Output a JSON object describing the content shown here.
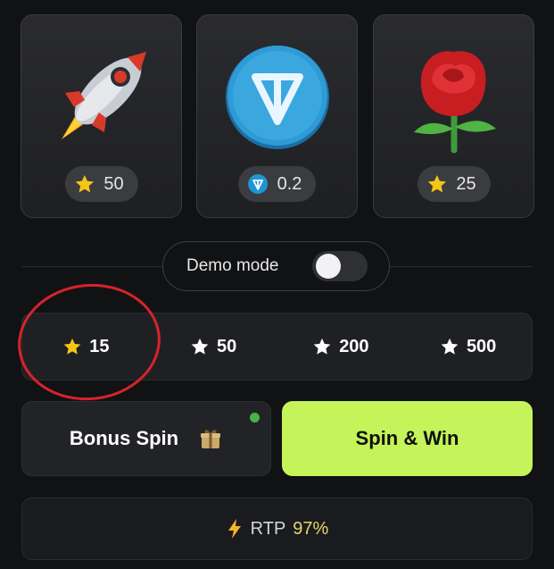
{
  "prizes": [
    {
      "name": "rocket",
      "currency": "star",
      "price": "50"
    },
    {
      "name": "ton-coin",
      "currency": "ton",
      "price": "0.2"
    },
    {
      "name": "rose",
      "currency": "star",
      "price": "25"
    }
  ],
  "demo": {
    "label": "Demo mode",
    "enabled": false
  },
  "bets": [
    {
      "value": "15",
      "icon": "star-yellow-icon",
      "selected": true
    },
    {
      "value": "50",
      "icon": "star-white-icon",
      "selected": false
    },
    {
      "value": "200",
      "icon": "star-white-icon",
      "selected": false
    },
    {
      "value": "500",
      "icon": "star-white-icon",
      "selected": false
    }
  ],
  "actions": {
    "bonus_label": "Bonus Spin",
    "spin_label": "Spin & Win"
  },
  "rtp": {
    "label": "RTP",
    "value": "97%"
  },
  "colors": {
    "accent": "#c4f45a",
    "star": "#f5c518",
    "ton": "#1e96d3",
    "annotation": "#d8232a"
  }
}
